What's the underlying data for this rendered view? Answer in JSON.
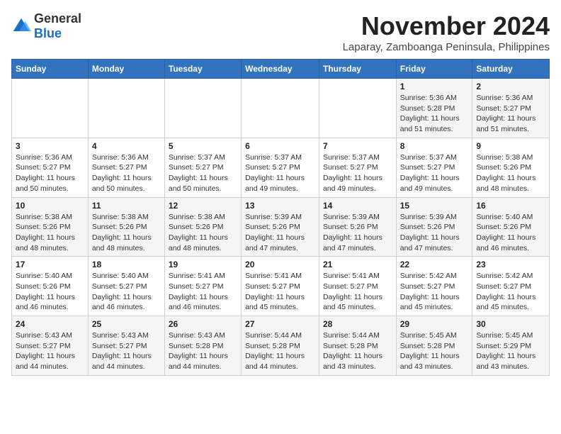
{
  "logo": {
    "general": "General",
    "blue": "Blue"
  },
  "title": "November 2024",
  "subtitle": "Laparay, Zamboanga Peninsula, Philippines",
  "days_of_week": [
    "Sunday",
    "Monday",
    "Tuesday",
    "Wednesday",
    "Thursday",
    "Friday",
    "Saturday"
  ],
  "weeks": [
    [
      {
        "day": "",
        "info": ""
      },
      {
        "day": "",
        "info": ""
      },
      {
        "day": "",
        "info": ""
      },
      {
        "day": "",
        "info": ""
      },
      {
        "day": "",
        "info": ""
      },
      {
        "day": "1",
        "info": "Sunrise: 5:36 AM\nSunset: 5:28 PM\nDaylight: 11 hours and 51 minutes."
      },
      {
        "day": "2",
        "info": "Sunrise: 5:36 AM\nSunset: 5:27 PM\nDaylight: 11 hours and 51 minutes."
      }
    ],
    [
      {
        "day": "3",
        "info": "Sunrise: 5:36 AM\nSunset: 5:27 PM\nDaylight: 11 hours and 50 minutes."
      },
      {
        "day": "4",
        "info": "Sunrise: 5:36 AM\nSunset: 5:27 PM\nDaylight: 11 hours and 50 minutes."
      },
      {
        "day": "5",
        "info": "Sunrise: 5:37 AM\nSunset: 5:27 PM\nDaylight: 11 hours and 50 minutes."
      },
      {
        "day": "6",
        "info": "Sunrise: 5:37 AM\nSunset: 5:27 PM\nDaylight: 11 hours and 49 minutes."
      },
      {
        "day": "7",
        "info": "Sunrise: 5:37 AM\nSunset: 5:27 PM\nDaylight: 11 hours and 49 minutes."
      },
      {
        "day": "8",
        "info": "Sunrise: 5:37 AM\nSunset: 5:27 PM\nDaylight: 11 hours and 49 minutes."
      },
      {
        "day": "9",
        "info": "Sunrise: 5:38 AM\nSunset: 5:26 PM\nDaylight: 11 hours and 48 minutes."
      }
    ],
    [
      {
        "day": "10",
        "info": "Sunrise: 5:38 AM\nSunset: 5:26 PM\nDaylight: 11 hours and 48 minutes."
      },
      {
        "day": "11",
        "info": "Sunrise: 5:38 AM\nSunset: 5:26 PM\nDaylight: 11 hours and 48 minutes."
      },
      {
        "day": "12",
        "info": "Sunrise: 5:38 AM\nSunset: 5:26 PM\nDaylight: 11 hours and 48 minutes."
      },
      {
        "day": "13",
        "info": "Sunrise: 5:39 AM\nSunset: 5:26 PM\nDaylight: 11 hours and 47 minutes."
      },
      {
        "day": "14",
        "info": "Sunrise: 5:39 AM\nSunset: 5:26 PM\nDaylight: 11 hours and 47 minutes."
      },
      {
        "day": "15",
        "info": "Sunrise: 5:39 AM\nSunset: 5:26 PM\nDaylight: 11 hours and 47 minutes."
      },
      {
        "day": "16",
        "info": "Sunrise: 5:40 AM\nSunset: 5:26 PM\nDaylight: 11 hours and 46 minutes."
      }
    ],
    [
      {
        "day": "17",
        "info": "Sunrise: 5:40 AM\nSunset: 5:26 PM\nDaylight: 11 hours and 46 minutes."
      },
      {
        "day": "18",
        "info": "Sunrise: 5:40 AM\nSunset: 5:27 PM\nDaylight: 11 hours and 46 minutes."
      },
      {
        "day": "19",
        "info": "Sunrise: 5:41 AM\nSunset: 5:27 PM\nDaylight: 11 hours and 46 minutes."
      },
      {
        "day": "20",
        "info": "Sunrise: 5:41 AM\nSunset: 5:27 PM\nDaylight: 11 hours and 45 minutes."
      },
      {
        "day": "21",
        "info": "Sunrise: 5:41 AM\nSunset: 5:27 PM\nDaylight: 11 hours and 45 minutes."
      },
      {
        "day": "22",
        "info": "Sunrise: 5:42 AM\nSunset: 5:27 PM\nDaylight: 11 hours and 45 minutes."
      },
      {
        "day": "23",
        "info": "Sunrise: 5:42 AM\nSunset: 5:27 PM\nDaylight: 11 hours and 45 minutes."
      }
    ],
    [
      {
        "day": "24",
        "info": "Sunrise: 5:43 AM\nSunset: 5:27 PM\nDaylight: 11 hours and 44 minutes."
      },
      {
        "day": "25",
        "info": "Sunrise: 5:43 AM\nSunset: 5:27 PM\nDaylight: 11 hours and 44 minutes."
      },
      {
        "day": "26",
        "info": "Sunrise: 5:43 AM\nSunset: 5:28 PM\nDaylight: 11 hours and 44 minutes."
      },
      {
        "day": "27",
        "info": "Sunrise: 5:44 AM\nSunset: 5:28 PM\nDaylight: 11 hours and 44 minutes."
      },
      {
        "day": "28",
        "info": "Sunrise: 5:44 AM\nSunset: 5:28 PM\nDaylight: 11 hours and 43 minutes."
      },
      {
        "day": "29",
        "info": "Sunrise: 5:45 AM\nSunset: 5:28 PM\nDaylight: 11 hours and 43 minutes."
      },
      {
        "day": "30",
        "info": "Sunrise: 5:45 AM\nSunset: 5:29 PM\nDaylight: 11 hours and 43 minutes."
      }
    ]
  ]
}
